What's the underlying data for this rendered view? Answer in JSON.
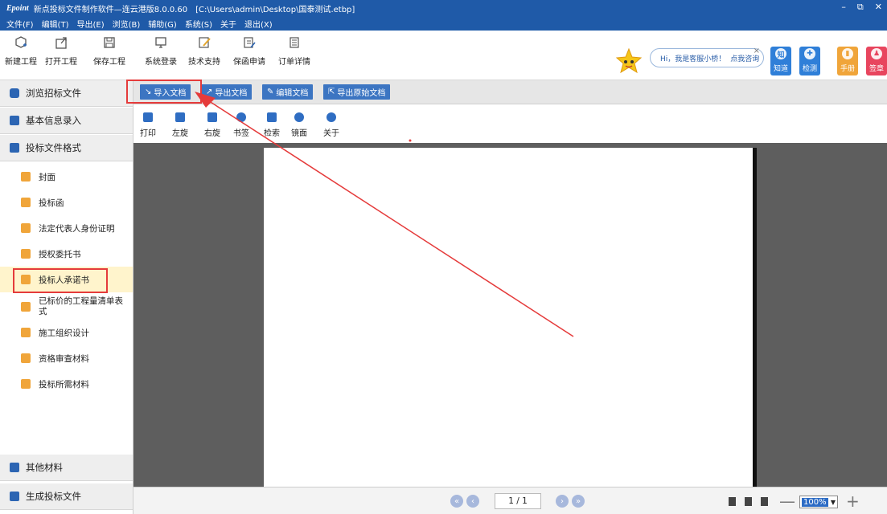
{
  "window": {
    "brand": "Epoint",
    "title": "新点投标文件制作软件—连云港版8.0.0.60",
    "path": "[C:\\Users\\admin\\Desktop\\国泰测试.etbp]",
    "min": "–",
    "restore": "⧉",
    "close": "✕"
  },
  "menu": [
    "文件(F)",
    "编辑(T)",
    "导出(E)",
    "浏览(B)",
    "辅助(G)",
    "系统(S)",
    "关于",
    "退出(X)"
  ],
  "ribbon": {
    "items": [
      "新建工程",
      "打开工程",
      "保存工程",
      "系统登录",
      "技术支持",
      "保函申请",
      "订单详情"
    ]
  },
  "assistant": {
    "greeting": "Hi，我是客服小桥！",
    "link": "点我咨询",
    "close": "×"
  },
  "tiles": [
    {
      "label": "知道",
      "glyph": "知",
      "color": "#2f7fd8"
    },
    {
      "label": "检测",
      "glyph": "✚",
      "color": "#2f7fd8"
    },
    {
      "label": "手册",
      "glyph": "▮",
      "color": "#f0a53a"
    },
    {
      "label": "签章",
      "glyph": "♟",
      "color": "#e8455e"
    }
  ],
  "sidebar": {
    "sections": [
      "浏览招标文件",
      "基本信息录入",
      "投标文件格式",
      "其他材料",
      "生成投标文件"
    ],
    "items": [
      "封面",
      "投标函",
      "法定代表人身份证明",
      "授权委托书",
      "投标人承诺书",
      "已标价的工程量清单表式",
      "施工组织设计",
      "资格审查材料",
      "投标所需材料"
    ],
    "active_item": "投标人承诺书"
  },
  "docbar": {
    "buttons": [
      "导入文档",
      "导出文档",
      "编辑文档",
      "导出原始文档"
    ]
  },
  "viewer_tools": [
    "打印",
    "左旋",
    "右旋",
    "书签",
    "检索",
    "镜面",
    "关于"
  ],
  "pager": {
    "page": "1 / 1",
    "zoom": "100%",
    "minus": "—",
    "plus": "+"
  },
  "colors": {
    "accent": "#1f5aa8",
    "button": "#3c75c2",
    "annotation": "#e53b3b"
  }
}
